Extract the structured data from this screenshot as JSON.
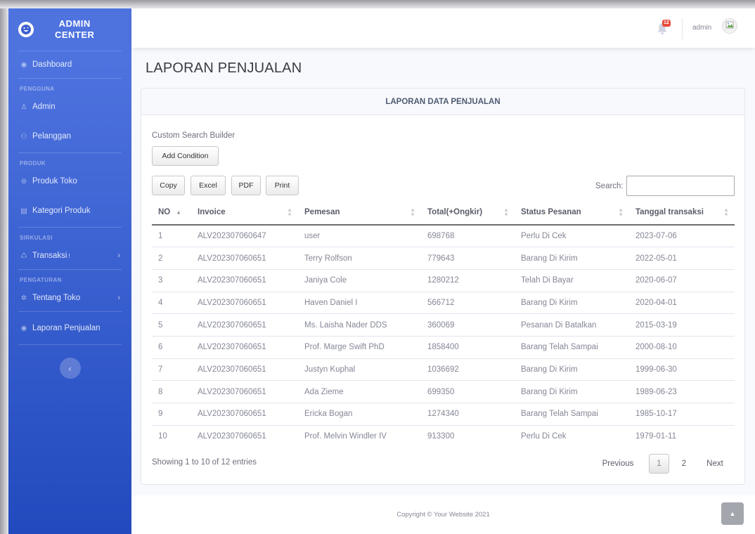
{
  "brand": {
    "line1": "ADMIN",
    "line2": "CENTER"
  },
  "sidebar": {
    "dashboard": "Dashboard",
    "heading_pengguna": "PENGGUNA",
    "admin": "Admin",
    "pelanggan": "Pelanggan",
    "heading_produk": "PRODUK",
    "produk_toko": "Produk Toko",
    "kategori_produk": "Kategori Produk",
    "heading_sirkulasi": "SIRKULASI",
    "transaksi": "Transaksi",
    "transaksi_sup": "!",
    "heading_pengaturan": "PENGATURAN",
    "tentang_toko": "Tentang Toko",
    "laporan_penjualan": "Laporan Penjualan"
  },
  "topbar": {
    "alert_count": "12",
    "user_name": "admin"
  },
  "page": {
    "title": "LAPORAN PENJUALAN"
  },
  "card": {
    "header": "LAPORAN DATA PENJUALAN",
    "search_builder_title": "Custom Search Builder",
    "add_condition": "Add Condition",
    "buttons": {
      "copy": "Copy",
      "excel": "Excel",
      "pdf": "PDF",
      "print": "Print"
    },
    "search_label": "Search:",
    "columns": [
      "NO",
      "Invoice",
      "Pemesan",
      "Total(+Ongkir)",
      "Status Pesanan",
      "Tanggal transaksi"
    ],
    "rows": [
      [
        "1",
        "ALV202307060647",
        "user",
        "698768",
        "Perlu Di Cek",
        "2023-07-06"
      ],
      [
        "2",
        "ALV202307060651",
        "Terry Rolfson",
        "779643",
        "Barang Di Kirim",
        "2022-05-01"
      ],
      [
        "3",
        "ALV202307060651",
        "Janiya Cole",
        "1280212",
        "Telah Di Bayar",
        "2020-06-07"
      ],
      [
        "4",
        "ALV202307060651",
        "Haven Daniel I",
        "566712",
        "Barang Di Kirim",
        "2020-04-01"
      ],
      [
        "5",
        "ALV202307060651",
        "Ms. Laisha Nader DDS",
        "360069",
        "Pesanan Di Batalkan",
        "2015-03-19"
      ],
      [
        "6",
        "ALV202307060651",
        "Prof. Marge Swift PhD",
        "1858400",
        "Barang Telah Sampai",
        "2000-08-10"
      ],
      [
        "7",
        "ALV202307060651",
        "Justyn Kuphal",
        "1036692",
        "Barang Di Kirim",
        "1999-06-30"
      ],
      [
        "8",
        "ALV202307060651",
        "Ada Zieme",
        "699350",
        "Barang Di Kirim",
        "1989-06-23"
      ],
      [
        "9",
        "ALV202307060651",
        "Ericka Bogan",
        "1274340",
        "Barang Telah Sampai",
        "1985-10-17"
      ],
      [
        "10",
        "ALV202307060651",
        "Prof. Melvin Windler IV",
        "913300",
        "Perlu Di Cek",
        "1979-01-11"
      ]
    ],
    "info": "Showing 1 to 10 of 12 entries",
    "pagination": {
      "previous": "Previous",
      "page1": "1",
      "page2": "2",
      "next": "Next"
    }
  },
  "footer": {
    "copyright": "Copyright © Your Website 2021"
  }
}
